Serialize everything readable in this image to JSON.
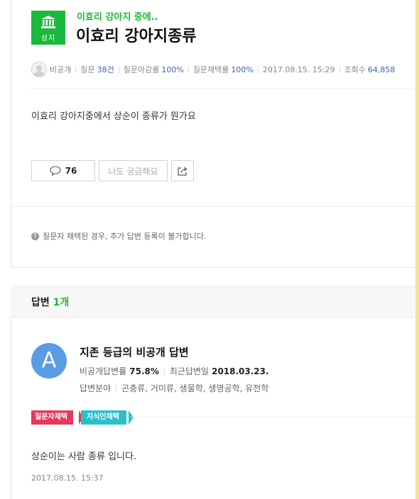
{
  "question": {
    "badge_label": "성지",
    "category": "이효리 강아지 중에..",
    "title": "이효리 강아지종류",
    "meta": {
      "author": "비공개",
      "questions_label": "질문",
      "questions_value": "38건",
      "close_rate_label": "질문마감률",
      "close_rate_value": "100%",
      "adopt_rate_label": "질문채택률",
      "adopt_rate_value": "100%",
      "date": "2017.08.15. 15:29",
      "views_label": "조회수",
      "views_value": "64,858"
    },
    "body": "이효리 강아지중에서 상순이 종류가 뭔가요",
    "comment_count": "76",
    "curious_label": "나도 궁금해요",
    "notice": "질문자 채택된 경우, 추가 답변 등록이 불가합니다."
  },
  "answers": {
    "header_label": "답변",
    "header_count": "1개",
    "answer": {
      "avatar_letter": "A",
      "name": "지존 등급의 비공개 답변",
      "adopt_rate_label": "비공개답변률",
      "adopt_rate_value": "75.8%",
      "recent_label": "최근답변일",
      "recent_value": "2018.03.23.",
      "field_label": "답변분야",
      "field_value": "곤충류, 거미류, 생물학, 생명공학, 유전학",
      "tag_asker": "질문자채택",
      "tag_jisik": "지식인채택",
      "body": "상순이는 사람 종류 입니다.",
      "date": "2017.08.15. 15:37"
    }
  },
  "colors": {
    "brand_green": "#19b93b",
    "link_blue": "#3e64b0",
    "tag_red": "#e8385a",
    "tag_teal": "#2bbfc9",
    "avatar_blue": "#5a9be5",
    "frame_yellow": "#fbf3c6"
  },
  "icons": {
    "badge": "building-icon",
    "comment": "speech-bubble-icon",
    "share": "share-icon",
    "notice": "info-icon"
  }
}
